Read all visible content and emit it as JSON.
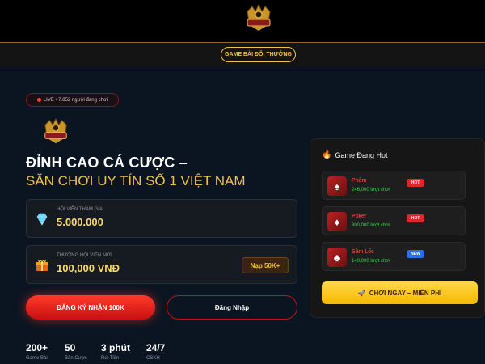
{
  "nav": {
    "pill_label": "GAME BÀI ĐỔI THƯỞNG"
  },
  "hero": {
    "live_text": "LIVE • 7.852 người đang chơi",
    "headline_line1": "ĐỈNH CAO CÁ CƯỢC –",
    "headline_line2": "SĂN CHƠI UY TÍN SỐ 1 VIỆT NAM"
  },
  "cards": [
    {
      "icon": "diamond-icon",
      "label": "HỘI VIÊN THAM GIA",
      "value": "5.000.000"
    },
    {
      "icon": "gift-icon",
      "label": "THƯỞNG HỘI VIÊN MỚI",
      "value": "100,000 VNĐ",
      "action_label": "Nạp 50K+"
    }
  ],
  "buttons": {
    "register_label": "ĐĂNG KÝ NHẬN 100K",
    "login_label": "Đăng Nhập"
  },
  "stats": [
    {
      "value": "200+",
      "label": "Game Bài"
    },
    {
      "value": "50",
      "label": "Bàn Cược"
    },
    {
      "value": "3 phút",
      "label": "Rút Tiền"
    },
    {
      "value": "24/7",
      "label": "CSKH"
    }
  ],
  "hot_panel": {
    "title": "Game Đang Hot",
    "games": [
      {
        "name": "Phỏm",
        "plays": "246,000 lượt chơi",
        "badge": "HOT",
        "badge_color": "#e0262a"
      },
      {
        "name": "Poker",
        "plays": "300,000 lượt chơi",
        "badge": "HOT",
        "badge_color": "#e0262a"
      },
      {
        "name": "Sâm Lốc",
        "plays": "140,000 lượt chơi",
        "badge": "NEW",
        "badge_color": "#2a6fe8"
      }
    ],
    "play_label": "CHƠI NGAY – MIỄN PHÍ"
  },
  "colors": {
    "gold": "#f0c14b",
    "accent_red": "#e0262a",
    "green": "#45d24a"
  }
}
